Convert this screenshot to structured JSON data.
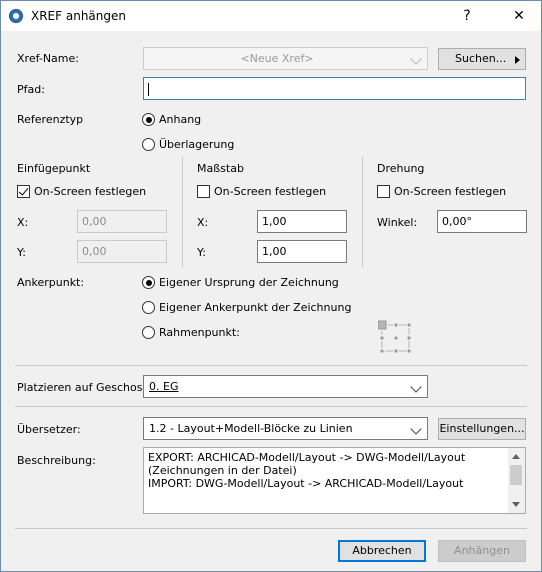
{
  "window": {
    "title": "XREF anhängen",
    "help_label": "?",
    "close_label": "✕"
  },
  "xref_name": {
    "label": "Xref-Name:",
    "value": "<Neue Xref>",
    "search_button": "Suchen..."
  },
  "path": {
    "label": "Pfad:",
    "value": ""
  },
  "reference_type": {
    "label": "Referenztyp",
    "options": [
      "Anhang",
      "Überlagerung"
    ],
    "selected": "Anhang"
  },
  "insertion_point": {
    "heading": "Einfügepunkt",
    "on_screen_label": "On-Screen festlegen",
    "on_screen_checked": true,
    "x_label": "X:",
    "x_value": "0,00",
    "y_label": "Y:",
    "y_value": "0,00"
  },
  "scale": {
    "heading": "Maßstab",
    "on_screen_label": "On-Screen festlegen",
    "on_screen_checked": false,
    "x_label": "X:",
    "x_value": "1,00",
    "y_label": "Y:",
    "y_value": "1,00"
  },
  "rotation": {
    "heading": "Drehung",
    "on_screen_label": "On-Screen festlegen",
    "on_screen_checked": false,
    "angle_label": "Winkel:",
    "angle_value": "0,00°"
  },
  "anchor_point": {
    "label": "Ankerpunkt:",
    "options": [
      "Eigener Ursprung der Zeichnung",
      "Eigener Ankerpunkt der Zeichnung",
      "Rahmenpunkt:"
    ],
    "selected": "Eigener Ursprung der Zeichnung"
  },
  "story": {
    "label": "Platzieren auf Geschoss",
    "value": "0. EG"
  },
  "translator": {
    "label": "Übersetzer:",
    "value": "1.2 - Layout+Modell-Blöcke zu Linien",
    "settings_button": "Einstellungen..."
  },
  "description": {
    "label": "Beschreibung:",
    "lines": [
      "EXPORT: ARCHICAD-Modell/Layout -> DWG-Modell/Layout",
      "(Zeichnungen in der Datei)",
      "IMPORT: DWG-Modell/Layout -> ARCHICAD-Modell/Layout"
    ]
  },
  "footer": {
    "cancel_button": "Abbrechen",
    "attach_button": "Anhängen"
  }
}
